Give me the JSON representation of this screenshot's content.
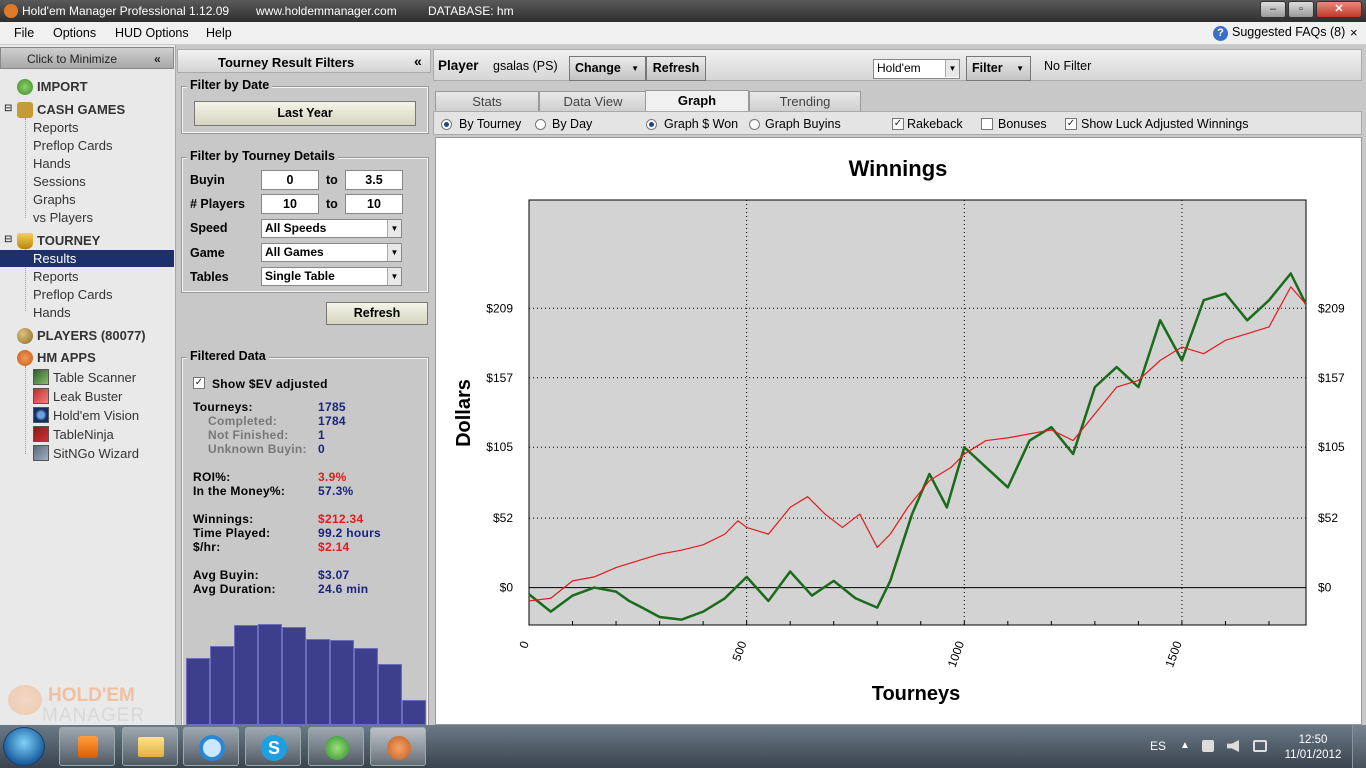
{
  "window": {
    "title": "Hold'em Manager Professional 1.12.09",
    "url": "www.holdemmanager.com",
    "database": "DATABASE: hm"
  },
  "menu": {
    "items": [
      "File",
      "Options",
      "HUD Options",
      "Help"
    ],
    "faq": "Suggested FAQs (8)",
    "close": "×"
  },
  "nav": {
    "minimize": "Click to Minimize",
    "collapse": "«",
    "import": "IMPORT",
    "cash_games": "CASH GAMES",
    "cash_items": [
      "Reports",
      "Preflop Cards",
      "Hands",
      "Sessions",
      "Graphs",
      "vs Players"
    ],
    "tourney": "TOURNEY",
    "tourney_items": [
      "Results",
      "Reports",
      "Preflop Cards",
      "Hands"
    ],
    "players": "PLAYERS (80077)",
    "hm_apps": "HM APPS",
    "apps": [
      "Table Scanner",
      "Leak Buster",
      "Hold'em Vision",
      "TableNinja",
      "SitNGo Wizard"
    ],
    "logo_top": "HOLD'EM",
    "logo_bottom": "MANAGER"
  },
  "filters": {
    "header": "Tourney Result Filters",
    "collapse": "«",
    "by_date_label": "Filter by Date",
    "date_button": "Last Year",
    "details_label": "Filter by Tourney Details",
    "buyin_label": "Buyin",
    "buyin_from": "0",
    "buyin_to": "3.5",
    "players_label": "# Players",
    "players_from": "10",
    "players_to": "10",
    "to_label": "to",
    "speed_label": "Speed",
    "speed_value": "All Speeds",
    "game_label": "Game",
    "game_value": "All Games",
    "tables_label": "Tables",
    "tables_value": "Single Table",
    "refresh": "Refresh"
  },
  "filtered_data": {
    "label": "Filtered Data",
    "show_sev": "Show $EV adjusted",
    "show_sev_checked": true,
    "tourneys_label": "Tourneys:",
    "tourneys": "1785",
    "completed_label": "Completed:",
    "completed": "1784",
    "not_finished_label": "Not Finished:",
    "not_finished": "1",
    "unknown_label": "Unknown Buyin:",
    "unknown": "0",
    "roi_label": "ROI%:",
    "roi": "3.9%",
    "itm_label": "In the Money%:",
    "itm": "57.3%",
    "winnings_label": "Winnings:",
    "winnings": "$212.34",
    "time_label": "Time Played:",
    "time": "99.2 hours",
    "hr_label": "$/hr:",
    "hr": "$2.14",
    "avg_buyin_label": "Avg Buyin:",
    "avg_buyin": "$3.07",
    "avg_duration_label": "Avg Duration:",
    "avg_duration": "24.6 min",
    "histogram": [
      0.56,
      0.66,
      0.83,
      0.84,
      0.82,
      0.72,
      0.71,
      0.64,
      0.51,
      0.21
    ]
  },
  "player_bar": {
    "player_label": "Player",
    "player_name": "gsalas (PS)",
    "change": "Change",
    "refresh": "Refresh",
    "game_type": "Hold'em",
    "filter": "Filter",
    "no_filter": "No Filter"
  },
  "tabs": [
    "Stats",
    "Data View",
    "Graph",
    "Trending"
  ],
  "options": {
    "by_tourney": "By Tourney",
    "by_day": "By Day",
    "graph_won": "Graph $ Won",
    "graph_buyins": "Graph Buyins",
    "rakeback": "Rakeback",
    "bonuses": "Bonuses",
    "luck": "Show Luck Adjusted Winnings",
    "check": "✓"
  },
  "chart_data": {
    "type": "line",
    "title": "Winnings",
    "xlabel": "Tourneys",
    "ylabel": "Dollars",
    "xlim": [
      0,
      1785
    ],
    "ylim": [
      -28,
      290
    ],
    "xticks": [
      "0",
      "500",
      "1000",
      "1500"
    ],
    "yticks": [
      "$0",
      "$52",
      "$105",
      "$157",
      "$209"
    ],
    "grid": true,
    "series": [
      {
        "color": "#1a6b1a",
        "x": [
          0,
          50,
          100,
          150,
          200,
          230,
          260,
          300,
          350,
          400,
          450,
          500,
          550,
          600,
          650,
          700,
          750,
          800,
          830,
          880,
          920,
          960,
          1000,
          1050,
          1100,
          1150,
          1200,
          1250,
          1300,
          1350,
          1400,
          1450,
          1500,
          1550,
          1600,
          1650,
          1700,
          1750,
          1785
        ],
        "y": [
          -5,
          -18,
          -6,
          0,
          -3,
          -10,
          -15,
          -22,
          -24,
          -18,
          -8,
          8,
          -10,
          12,
          -6,
          5,
          -8,
          -15,
          5,
          55,
          85,
          60,
          105,
          90,
          75,
          110,
          120,
          100,
          150,
          165,
          150,
          200,
          170,
          215,
          220,
          200,
          215,
          235,
          212
        ]
      },
      {
        "color": "#e31b1b",
        "x": [
          0,
          50,
          100,
          150,
          200,
          250,
          300,
          350,
          400,
          450,
          480,
          500,
          550,
          600,
          640,
          680,
          720,
          760,
          800,
          830,
          870,
          920,
          970,
          1000,
          1050,
          1100,
          1150,
          1200,
          1250,
          1300,
          1350,
          1400,
          1450,
          1500,
          1550,
          1600,
          1650,
          1700,
          1750,
          1785
        ],
        "y": [
          -10,
          -8,
          5,
          8,
          15,
          20,
          25,
          28,
          32,
          40,
          50,
          45,
          40,
          60,
          68,
          55,
          45,
          55,
          30,
          40,
          60,
          80,
          90,
          100,
          110,
          112,
          115,
          118,
          110,
          130,
          150,
          155,
          170,
          180,
          175,
          185,
          190,
          195,
          225,
          212
        ]
      }
    ]
  },
  "taskbar": {
    "lang": "ES",
    "time": "12:50",
    "date": "11/01/2012"
  }
}
